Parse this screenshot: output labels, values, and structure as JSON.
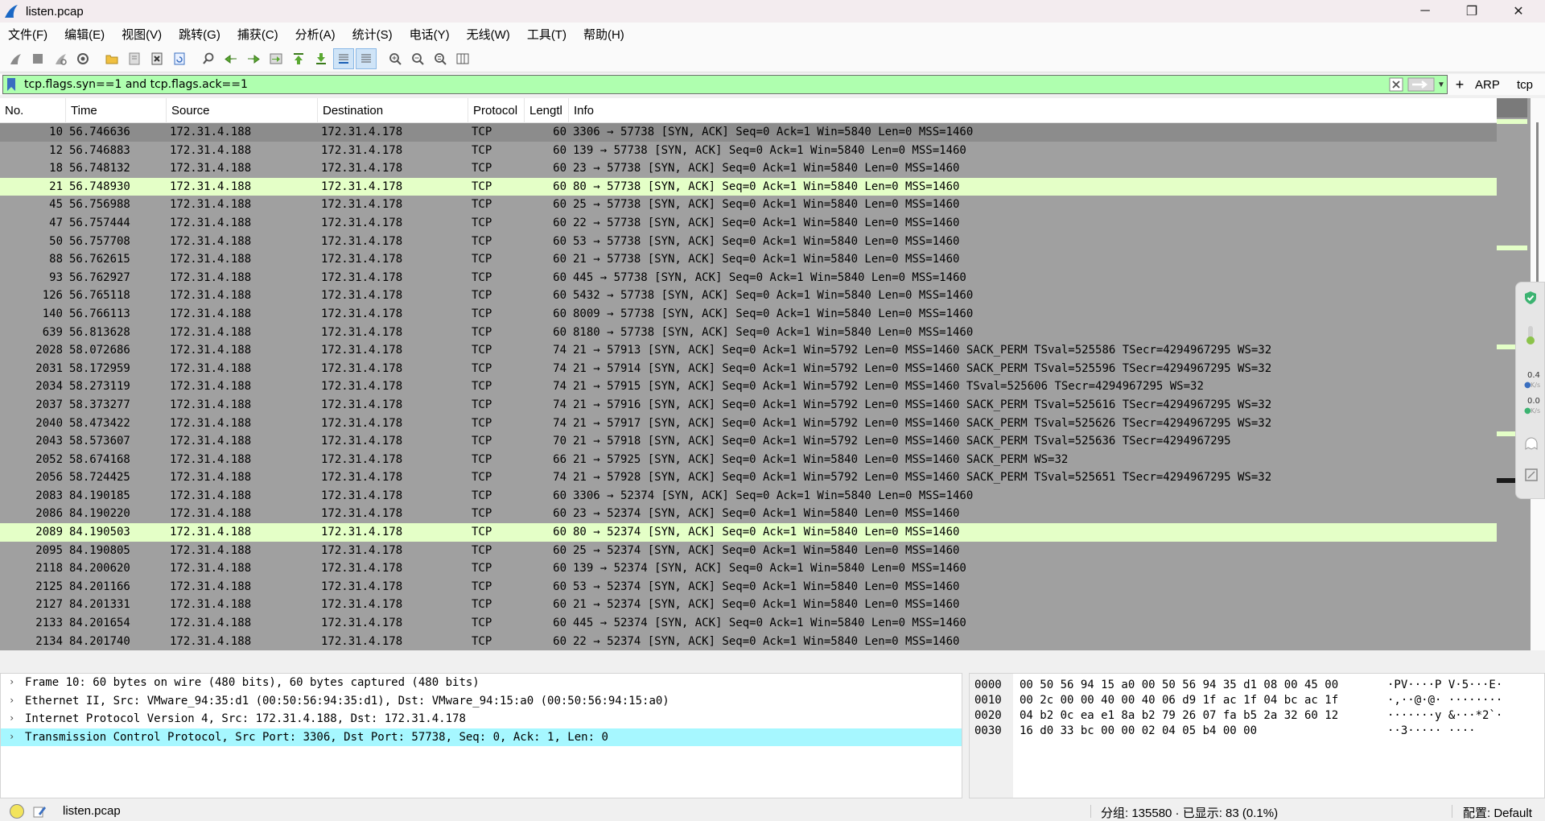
{
  "window": {
    "title": "listen.pcap",
    "minimize_glyph": "─",
    "maximize_glyph": "❐",
    "close_glyph": "✕"
  },
  "menu": [
    "文件(F)",
    "编辑(E)",
    "视图(V)",
    "跳转(G)",
    "捕获(C)",
    "分析(A)",
    "统计(S)",
    "电话(Y)",
    "无线(W)",
    "工具(T)",
    "帮助(H)"
  ],
  "toolbar_icons": [
    "start-capture-icon",
    "stop-capture-icon",
    "restart-capture-icon",
    "capture-options-icon",
    "open-file-icon",
    "save-file-icon",
    "close-file-icon",
    "reload-file-icon",
    "find-packet-icon",
    "go-back-icon",
    "go-forward-icon",
    "go-to-packet-icon",
    "first-packet-icon",
    "last-packet-icon",
    "autoscroll-icon",
    "colorize-icon",
    "zoom-in-icon",
    "zoom-out-icon",
    "normal-size-icon",
    "resize-columns-icon"
  ],
  "filter": {
    "value": "tcp.flags.syn==1 and tcp.flags.ack==1",
    "background": "#afffaf",
    "plus": "+",
    "buttons": [
      "ARP",
      "tcp"
    ]
  },
  "columns": [
    "No.",
    "Time",
    "Source",
    "Destination",
    "Protocol",
    "Length",
    "Info"
  ],
  "column_display": [
    "No.",
    "Time",
    "Source",
    "Destination",
    "Protocol",
    "Lengtl",
    "Info"
  ],
  "packets": [
    {
      "no": "10",
      "time": "56.746636",
      "src": "172.31.4.188",
      "dst": "172.31.4.178",
      "proto": "TCP",
      "len": "60",
      "info": "3306 → 57738 [SYN, ACK] Seq=0 Ack=1 Win=5840 Len=0 MSS=1460",
      "style": "sel"
    },
    {
      "no": "12",
      "time": "56.746883",
      "src": "172.31.4.188",
      "dst": "172.31.4.178",
      "proto": "TCP",
      "len": "60",
      "info": "139 → 57738 [SYN, ACK] Seq=0 Ack=1 Win=5840 Len=0 MSS=1460",
      "style": ""
    },
    {
      "no": "18",
      "time": "56.748132",
      "src": "172.31.4.188",
      "dst": "172.31.4.178",
      "proto": "TCP",
      "len": "60",
      "info": "23 → 57738 [SYN, ACK] Seq=0 Ack=1 Win=5840 Len=0 MSS=1460",
      "style": ""
    },
    {
      "no": "21",
      "time": "56.748930",
      "src": "172.31.4.188",
      "dst": "172.31.4.178",
      "proto": "TCP",
      "len": "60",
      "info": "80 → 57738 [SYN, ACK] Seq=0 Ack=1 Win=5840 Len=0 MSS=1460",
      "style": "http"
    },
    {
      "no": "45",
      "time": "56.756988",
      "src": "172.31.4.188",
      "dst": "172.31.4.178",
      "proto": "TCP",
      "len": "60",
      "info": "25 → 57738 [SYN, ACK] Seq=0 Ack=1 Win=5840 Len=0 MSS=1460",
      "style": ""
    },
    {
      "no": "47",
      "time": "56.757444",
      "src": "172.31.4.188",
      "dst": "172.31.4.178",
      "proto": "TCP",
      "len": "60",
      "info": "22 → 57738 [SYN, ACK] Seq=0 Ack=1 Win=5840 Len=0 MSS=1460",
      "style": ""
    },
    {
      "no": "50",
      "time": "56.757708",
      "src": "172.31.4.188",
      "dst": "172.31.4.178",
      "proto": "TCP",
      "len": "60",
      "info": "53 → 57738 [SYN, ACK] Seq=0 Ack=1 Win=5840 Len=0 MSS=1460",
      "style": ""
    },
    {
      "no": "88",
      "time": "56.762615",
      "src": "172.31.4.188",
      "dst": "172.31.4.178",
      "proto": "TCP",
      "len": "60",
      "info": "21 → 57738 [SYN, ACK] Seq=0 Ack=1 Win=5840 Len=0 MSS=1460",
      "style": ""
    },
    {
      "no": "93",
      "time": "56.762927",
      "src": "172.31.4.188",
      "dst": "172.31.4.178",
      "proto": "TCP",
      "len": "60",
      "info": "445 → 57738 [SYN, ACK] Seq=0 Ack=1 Win=5840 Len=0 MSS=1460",
      "style": ""
    },
    {
      "no": "126",
      "time": "56.765118",
      "src": "172.31.4.188",
      "dst": "172.31.4.178",
      "proto": "TCP",
      "len": "60",
      "info": "5432 → 57738 [SYN, ACK] Seq=0 Ack=1 Win=5840 Len=0 MSS=1460",
      "style": ""
    },
    {
      "no": "140",
      "time": "56.766113",
      "src": "172.31.4.188",
      "dst": "172.31.4.178",
      "proto": "TCP",
      "len": "60",
      "info": "8009 → 57738 [SYN, ACK] Seq=0 Ack=1 Win=5840 Len=0 MSS=1460",
      "style": ""
    },
    {
      "no": "639",
      "time": "56.813628",
      "src": "172.31.4.188",
      "dst": "172.31.4.178",
      "proto": "TCP",
      "len": "60",
      "info": "8180 → 57738 [SYN, ACK] Seq=0 Ack=1 Win=5840 Len=0 MSS=1460",
      "style": ""
    },
    {
      "no": "2028",
      "time": "58.072686",
      "src": "172.31.4.188",
      "dst": "172.31.4.178",
      "proto": "TCP",
      "len": "74",
      "info": "21 → 57913 [SYN, ACK] Seq=0 Ack=1 Win=5792 Len=0 MSS=1460 SACK_PERM TSval=525586 TSecr=4294967295 WS=32",
      "style": ""
    },
    {
      "no": "2031",
      "time": "58.172959",
      "src": "172.31.4.188",
      "dst": "172.31.4.178",
      "proto": "TCP",
      "len": "74",
      "info": "21 → 57914 [SYN, ACK] Seq=0 Ack=1 Win=5792 Len=0 MSS=1460 SACK_PERM TSval=525596 TSecr=4294967295 WS=32",
      "style": ""
    },
    {
      "no": "2034",
      "time": "58.273119",
      "src": "172.31.4.188",
      "dst": "172.31.4.178",
      "proto": "TCP",
      "len": "74",
      "info": "21 → 57915 [SYN, ACK] Seq=0 Ack=1 Win=5792 Len=0 MSS=1460 TSval=525606 TSecr=4294967295 WS=32",
      "style": ""
    },
    {
      "no": "2037",
      "time": "58.373277",
      "src": "172.31.4.188",
      "dst": "172.31.4.178",
      "proto": "TCP",
      "len": "74",
      "info": "21 → 57916 [SYN, ACK] Seq=0 Ack=1 Win=5792 Len=0 MSS=1460 SACK_PERM TSval=525616 TSecr=4294967295 WS=32",
      "style": ""
    },
    {
      "no": "2040",
      "time": "58.473422",
      "src": "172.31.4.188",
      "dst": "172.31.4.178",
      "proto": "TCP",
      "len": "74",
      "info": "21 → 57917 [SYN, ACK] Seq=0 Ack=1 Win=5792 Len=0 MSS=1460 SACK_PERM TSval=525626 TSecr=4294967295 WS=32",
      "style": ""
    },
    {
      "no": "2043",
      "time": "58.573607",
      "src": "172.31.4.188",
      "dst": "172.31.4.178",
      "proto": "TCP",
      "len": "70",
      "info": "21 → 57918 [SYN, ACK] Seq=0 Ack=1 Win=5792 Len=0 MSS=1460 SACK_PERM TSval=525636 TSecr=4294967295",
      "style": ""
    },
    {
      "no": "2052",
      "time": "58.674168",
      "src": "172.31.4.188",
      "dst": "172.31.4.178",
      "proto": "TCP",
      "len": "66",
      "info": "21 → 57925 [SYN, ACK] Seq=0 Ack=1 Win=5840 Len=0 MSS=1460 SACK_PERM WS=32",
      "style": ""
    },
    {
      "no": "2056",
      "time": "58.724425",
      "src": "172.31.4.188",
      "dst": "172.31.4.178",
      "proto": "TCP",
      "len": "74",
      "info": "21 → 57928 [SYN, ACK] Seq=0 Ack=1 Win=5792 Len=0 MSS=1460 SACK_PERM TSval=525651 TSecr=4294967295 WS=32",
      "style": ""
    },
    {
      "no": "2083",
      "time": "84.190185",
      "src": "172.31.4.188",
      "dst": "172.31.4.178",
      "proto": "TCP",
      "len": "60",
      "info": "3306 → 52374 [SYN, ACK] Seq=0 Ack=1 Win=5840 Len=0 MSS=1460",
      "style": ""
    },
    {
      "no": "2086",
      "time": "84.190220",
      "src": "172.31.4.188",
      "dst": "172.31.4.178",
      "proto": "TCP",
      "len": "60",
      "info": "23 → 52374 [SYN, ACK] Seq=0 Ack=1 Win=5840 Len=0 MSS=1460",
      "style": ""
    },
    {
      "no": "2089",
      "time": "84.190503",
      "src": "172.31.4.188",
      "dst": "172.31.4.178",
      "proto": "TCP",
      "len": "60",
      "info": "80 → 52374 [SYN, ACK] Seq=0 Ack=1 Win=5840 Len=0 MSS=1460",
      "style": "http"
    },
    {
      "no": "2095",
      "time": "84.190805",
      "src": "172.31.4.188",
      "dst": "172.31.4.178",
      "proto": "TCP",
      "len": "60",
      "info": "25 → 52374 [SYN, ACK] Seq=0 Ack=1 Win=5840 Len=0 MSS=1460",
      "style": ""
    },
    {
      "no": "2118",
      "time": "84.200620",
      "src": "172.31.4.188",
      "dst": "172.31.4.178",
      "proto": "TCP",
      "len": "60",
      "info": "139 → 52374 [SYN, ACK] Seq=0 Ack=1 Win=5840 Len=0 MSS=1460",
      "style": ""
    },
    {
      "no": "2125",
      "time": "84.201166",
      "src": "172.31.4.188",
      "dst": "172.31.4.178",
      "proto": "TCP",
      "len": "60",
      "info": "53 → 52374 [SYN, ACK] Seq=0 Ack=1 Win=5840 Len=0 MSS=1460",
      "style": ""
    },
    {
      "no": "2127",
      "time": "84.201331",
      "src": "172.31.4.188",
      "dst": "172.31.4.178",
      "proto": "TCP",
      "len": "60",
      "info": "21 → 52374 [SYN, ACK] Seq=0 Ack=1 Win=5840 Len=0 MSS=1460",
      "style": ""
    },
    {
      "no": "2133",
      "time": "84.201654",
      "src": "172.31.4.188",
      "dst": "172.31.4.178",
      "proto": "TCP",
      "len": "60",
      "info": "445 → 52374 [SYN, ACK] Seq=0 Ack=1 Win=5840 Len=0 MSS=1460",
      "style": ""
    },
    {
      "no": "2134",
      "time": "84.201740",
      "src": "172.31.4.188",
      "dst": "172.31.4.178",
      "proto": "TCP",
      "len": "60",
      "info": "22 → 52374 [SYN, ACK] Seq=0 Ack=1 Win=5840 Len=0 MSS=1460",
      "style": ""
    }
  ],
  "details": [
    {
      "text": "Frame 10: 60 bytes on wire (480 bits), 60 bytes captured (480 bits)",
      "selected": false
    },
    {
      "text": "Ethernet II, Src: VMware_94:35:d1 (00:50:56:94:35:d1), Dst: VMware_94:15:a0 (00:50:56:94:15:a0)",
      "selected": false
    },
    {
      "text": "Internet Protocol Version 4, Src: 172.31.4.188, Dst: 172.31.4.178",
      "selected": false
    },
    {
      "text": "Transmission Control Protocol, Src Port: 3306, Dst Port: 57738, Seq: 0, Ack: 1, Len: 0",
      "selected": true
    }
  ],
  "bytes": [
    {
      "offset": "0000",
      "hex": "00 50 56 94 15 a0 00 50  56 94 35 d1 08 00 45 00",
      "ascii": "·PV····P V·5···E·"
    },
    {
      "offset": "0010",
      "hex": "00 2c 00 00 40 00 40 06  d9 1f ac 1f 04 bc ac 1f",
      "ascii": "·,··@·@· ········"
    },
    {
      "offset": "0020",
      "hex": "04 b2 0c ea e1 8a b2 79  26 07 fa b5 2a 32 60 12",
      "ascii": "·······y &···*2`·"
    },
    {
      "offset": "0030",
      "hex": "16 d0 33 bc 00 00 02 04  05 b4 00 00",
      "ascii": "··3····· ····"
    }
  ],
  "widget": {
    "up_rate": "0.4",
    "down_rate": "0.0",
    "unit": "K/s"
  },
  "status": {
    "file": "listen.pcap",
    "counts": "分组: 135580 · 已显示: 83 (0.1%)",
    "profile": "配置: Default"
  },
  "colors": {
    "selected_row": "#8c8c8c",
    "http_row": "#e4ffc7",
    "tcp_row": "#a0a0a0",
    "detail_selected": "#a6f7ff",
    "filter_valid": "#afffaf"
  }
}
